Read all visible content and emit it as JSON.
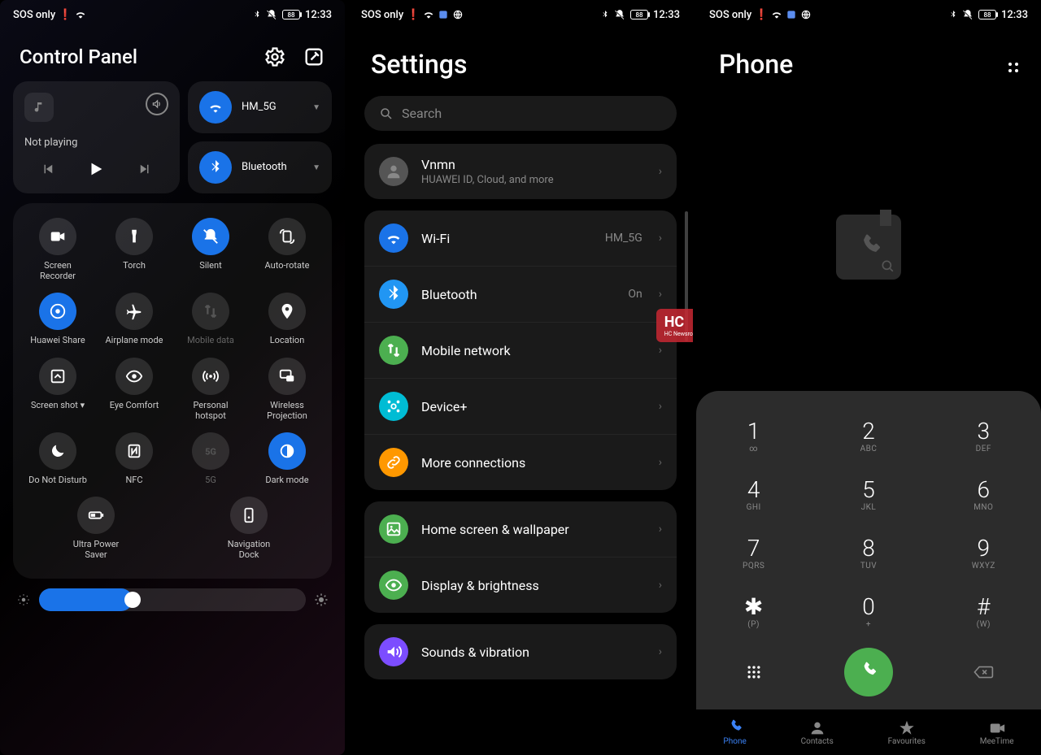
{
  "status": {
    "carrier": "SOS only",
    "battery": "88",
    "time": "12:33"
  },
  "control_panel": {
    "title": "Control Panel",
    "media": {
      "status": "Not playing"
    },
    "wifi": {
      "label": "HM_5G"
    },
    "bluetooth": {
      "label": "Bluetooth"
    },
    "toggles": [
      [
        {
          "name": "screen-recorder",
          "label": "Screen Recorder",
          "icon": "video",
          "active": false
        },
        {
          "name": "torch",
          "label": "Torch",
          "icon": "torch",
          "active": false
        },
        {
          "name": "silent",
          "label": "Silent",
          "icon": "bell-off",
          "active": true
        },
        {
          "name": "auto-rotate",
          "label": "Auto-rotate",
          "icon": "rotate",
          "active": false
        }
      ],
      [
        {
          "name": "huawei-share",
          "label": "Huawei Share",
          "icon": "share",
          "active": true
        },
        {
          "name": "airplane-mode",
          "label": "Airplane mode",
          "icon": "plane",
          "active": false
        },
        {
          "name": "mobile-data",
          "label": "Mobile data",
          "icon": "data",
          "active": false,
          "disabled": true
        },
        {
          "name": "location",
          "label": "Location",
          "icon": "pin",
          "active": false
        }
      ],
      [
        {
          "name": "screenshot",
          "label": "Screen shot",
          "icon": "screenshot",
          "active": false,
          "drop": true
        },
        {
          "name": "eye-comfort",
          "label": "Eye Comfort",
          "icon": "eye",
          "active": false
        },
        {
          "name": "personal-hotspot",
          "label": "Personal hotspot",
          "icon": "hotspot",
          "active": false
        },
        {
          "name": "wireless-projection",
          "label": "Wireless Projection",
          "icon": "cast",
          "active": false
        }
      ],
      [
        {
          "name": "do-not-disturb",
          "label": "Do Not Disturb",
          "icon": "moon",
          "active": false
        },
        {
          "name": "nfc",
          "label": "NFC",
          "icon": "nfc",
          "active": false
        },
        {
          "name": "5g",
          "label": "5G",
          "icon": "5g",
          "active": false,
          "disabled": true
        },
        {
          "name": "dark-mode",
          "label": "Dark mode",
          "icon": "dark",
          "active": true
        }
      ],
      [
        {
          "name": "ultra-power-saver",
          "label": "Ultra Power Saver",
          "icon": "battery",
          "active": false
        },
        {
          "name": "navigation-dock",
          "label": "Navigation Dock",
          "icon": "dock",
          "active": false
        }
      ]
    ]
  },
  "settings": {
    "title": "Settings",
    "search_placeholder": "Search",
    "account": {
      "name": "Vnmn",
      "sub": "HUAWEI ID, Cloud, and more"
    },
    "group1": [
      {
        "name": "wifi",
        "label": "Wi-Fi",
        "value": "HM_5G",
        "iconClass": "blue",
        "icon": "wifi"
      },
      {
        "name": "bluetooth",
        "label": "Bluetooth",
        "value": "On",
        "iconClass": "blue2",
        "icon": "bluetooth"
      },
      {
        "name": "mobile-network",
        "label": "Mobile network",
        "iconClass": "green",
        "icon": "data"
      },
      {
        "name": "device-plus",
        "label": "Device+",
        "iconClass": "cyan",
        "icon": "deviceplus"
      },
      {
        "name": "more-connections",
        "label": "More connections",
        "iconClass": "orange",
        "icon": "link"
      }
    ],
    "group2": [
      {
        "name": "home-wallpaper",
        "label": "Home screen & wallpaper",
        "iconClass": "green",
        "icon": "image"
      },
      {
        "name": "display-brightness",
        "label": "Display & brightness",
        "iconClass": "green",
        "icon": "eye"
      }
    ],
    "group3": [
      {
        "name": "sounds-vibration",
        "label": "Sounds & vibration",
        "iconClass": "purple",
        "icon": "sound"
      }
    ]
  },
  "phone_app": {
    "title": "Phone",
    "keys": [
      {
        "num": "1",
        "sub": "∞"
      },
      {
        "num": "2",
        "sub": "ABC"
      },
      {
        "num": "3",
        "sub": "DEF"
      },
      {
        "num": "4",
        "sub": "GHI"
      },
      {
        "num": "5",
        "sub": "JKL"
      },
      {
        "num": "6",
        "sub": "MNO"
      },
      {
        "num": "7",
        "sub": "PQRS"
      },
      {
        "num": "8",
        "sub": "TUV"
      },
      {
        "num": "9",
        "sub": "WXYZ"
      },
      {
        "num": "✱",
        "sub": "(P)"
      },
      {
        "num": "0",
        "sub": "+"
      },
      {
        "num": "#",
        "sub": "(W)"
      }
    ],
    "nav": [
      {
        "name": "phone",
        "label": "Phone",
        "active": true
      },
      {
        "name": "contacts",
        "label": "Contacts",
        "active": false
      },
      {
        "name": "favourites",
        "label": "Favourites",
        "active": false
      },
      {
        "name": "meetime",
        "label": "MeeTime",
        "active": false
      }
    ]
  },
  "watermark": {
    "main": "HC",
    "sub": "HC Newsroom"
  }
}
